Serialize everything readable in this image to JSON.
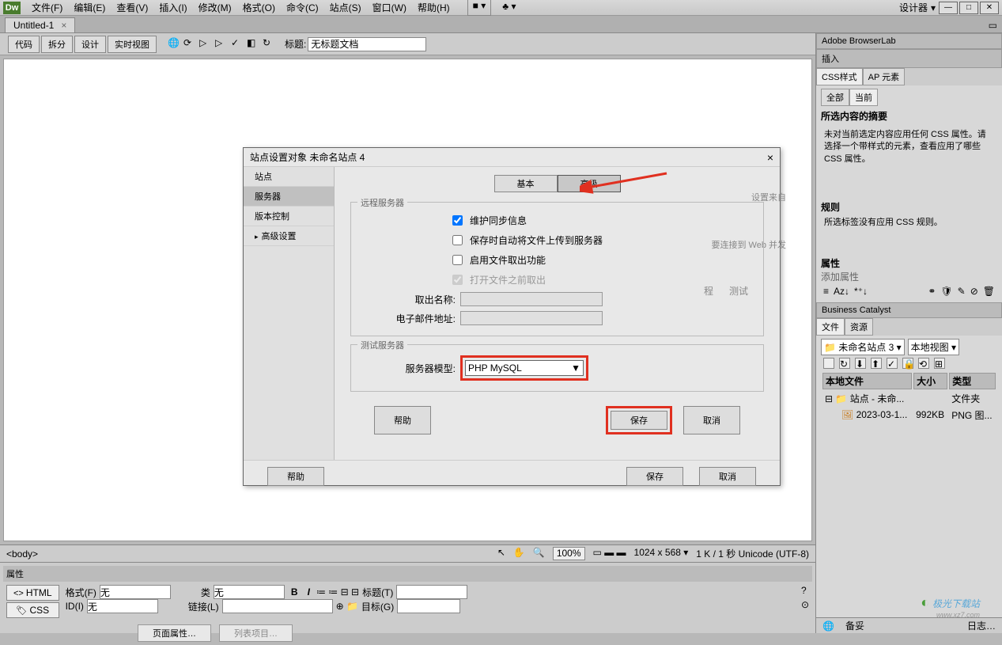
{
  "app": {
    "logo": "Dw",
    "designer": "设计器"
  },
  "menubar": [
    "文件(F)",
    "编辑(E)",
    "查看(V)",
    "插入(I)",
    "修改(M)",
    "格式(O)",
    "命令(C)",
    "站点(S)",
    "窗口(W)",
    "帮助(H)"
  ],
  "doc_tab": {
    "name": "Untitled-1",
    "close": "×"
  },
  "toolbar": {
    "code": "代码",
    "split": "拆分",
    "design": "设计",
    "live": "实时视图",
    "title_label": "标题:",
    "title_value": "无标题文档"
  },
  "dialog": {
    "title": "站点设置对象 未命名站点 4",
    "close": "×",
    "side": [
      "站点",
      "服务器",
      "版本控制",
      "高级设置"
    ],
    "side_selected": 1,
    "tabs": {
      "basic": "基本",
      "advanced": "高级"
    },
    "remote_legend": "远程服务器",
    "chk1": "维护同步信息",
    "chk2": "保存时自动将文件上传到服务器",
    "chk3": "启用文件取出功能",
    "chk4": "打开文件之前取出",
    "name_label": "取出名称:",
    "email_label": "电子邮件地址:",
    "test_legend": "测试服务器",
    "model_label": "服务器模型:",
    "model_value": "PHP MySQL",
    "help": "帮助",
    "save": "保存",
    "cancel": "取消",
    "bg_text1": "设置来自",
    "bg_text2": "要连接到 Web 并发",
    "bg_text3": "程",
    "bg_text4": "测试"
  },
  "status": {
    "body": "<body>",
    "zoom": "100%",
    "dims": "1024 x 568 ▾",
    "info": "1 K / 1 秒 Unicode (UTF-8)"
  },
  "props": {
    "header": "属性",
    "html_btn": "HTML",
    "css_btn": "CSS",
    "format_lbl": "格式(F)",
    "format_val": "无",
    "id_lbl": "ID(I)",
    "id_val": "无",
    "class_lbl": "类",
    "class_val": "无",
    "link_lbl": "链接(L)",
    "title_lbl": "标题(T)",
    "target_lbl": "目标(G)",
    "page_props": "页面属性…",
    "list_items": "列表项目…"
  },
  "panels": {
    "browserlab": "Adobe BrowserLab",
    "insert": "插入",
    "css_tab": "CSS样式",
    "ap_tab": "AP 元素",
    "all": "全部",
    "current": "当前",
    "sum_hdr": "所选内容的摘要",
    "sum_body": "未对当前选定内容应用任何 CSS 属性。请选择一个带样式的元素，查看应用了哪些 CSS 属性。",
    "rules_hdr": "规则",
    "rules_body": "所选标签没有应用 CSS 规则。",
    "props_hdr": "属性",
    "add_prop": "添加属性",
    "bc": "Business Catalyst",
    "files_tab": "文件",
    "res_tab": "资源",
    "site_sel": "未命名站点 3",
    "view_sel": "本地视图",
    "col_file": "本地文件",
    "col_size": "大小",
    "col_type": "类型",
    "row1_name": "站点 - 未命...",
    "row1_type": "文件夹",
    "row2_name": "2023-03-1...",
    "row2_size": "992KB",
    "row2_type": "PNG 图...",
    "ready": "备妥",
    "log": "日志…"
  },
  "watermark": "极光下载站"
}
